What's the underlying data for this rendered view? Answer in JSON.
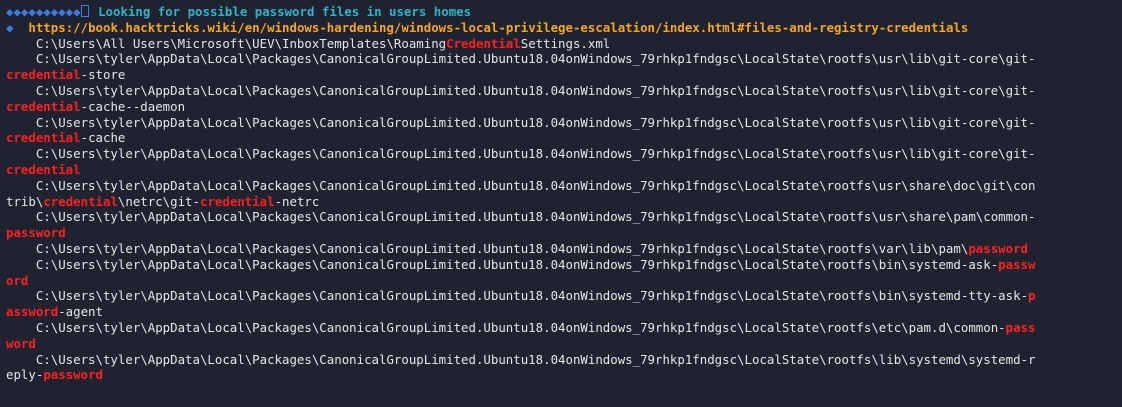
{
  "header": {
    "diamonds": "◆◆◆◆◆◆◆◆◆◆",
    "title": "Looking for possible password files in users homes"
  },
  "reference": {
    "bullet": "◆",
    "url": "https://book.hacktricks.wiki/en/windows-hardening/windows-local-privilege-escalation/index.html#files-and-registry-credentials"
  },
  "lines": [
    [
      "    C:\\Users\\All Users\\Microsoft\\UEV\\InboxTemplates\\Roaming",
      "Credential",
      "Settings.xml"
    ],
    [
      "    C:\\Users\\tyler\\AppData\\Local\\Packages\\CanonicalGroupLimited.Ubuntu18.04onWindows_79rhkp1fndgsc\\LocalState\\rootfs\\usr\\lib\\git-core\\git-"
    ],
    [
      "",
      "credential",
      "-store"
    ],
    [
      "    C:\\Users\\tyler\\AppData\\Local\\Packages\\CanonicalGroupLimited.Ubuntu18.04onWindows_79rhkp1fndgsc\\LocalState\\rootfs\\usr\\lib\\git-core\\git-"
    ],
    [
      "",
      "credential",
      "-cache--daemon"
    ],
    [
      "    C:\\Users\\tyler\\AppData\\Local\\Packages\\CanonicalGroupLimited.Ubuntu18.04onWindows_79rhkp1fndgsc\\LocalState\\rootfs\\usr\\lib\\git-core\\git-"
    ],
    [
      "",
      "credential",
      "-cache"
    ],
    [
      "    C:\\Users\\tyler\\AppData\\Local\\Packages\\CanonicalGroupLimited.Ubuntu18.04onWindows_79rhkp1fndgsc\\LocalState\\rootfs\\usr\\lib\\git-core\\git-"
    ],
    [
      "",
      "credential"
    ],
    [
      "    C:\\Users\\tyler\\AppData\\Local\\Packages\\CanonicalGroupLimited.Ubuntu18.04onWindows_79rhkp1fndgsc\\LocalState\\rootfs\\usr\\share\\doc\\git\\con"
    ],
    [
      "trib\\",
      "credential",
      "\\netrc\\git-",
      "credential",
      "-netrc"
    ],
    [
      "    C:\\Users\\tyler\\AppData\\Local\\Packages\\CanonicalGroupLimited.Ubuntu18.04onWindows_79rhkp1fndgsc\\LocalState\\rootfs\\usr\\share\\pam\\common-"
    ],
    [
      "",
      "password"
    ],
    [
      "    C:\\Users\\tyler\\AppData\\Local\\Packages\\CanonicalGroupLimited.Ubuntu18.04onWindows_79rhkp1fndgsc\\LocalState\\rootfs\\var\\lib\\pam\\",
      "password"
    ],
    [
      "    C:\\Users\\tyler\\AppData\\Local\\Packages\\CanonicalGroupLimited.Ubuntu18.04onWindows_79rhkp1fndgsc\\LocalState\\rootfs\\bin\\systemd-ask-",
      "passw"
    ],
    [
      "",
      "ord"
    ],
    [
      "    C:\\Users\\tyler\\AppData\\Local\\Packages\\CanonicalGroupLimited.Ubuntu18.04onWindows_79rhkp1fndgsc\\LocalState\\rootfs\\bin\\systemd-tty-ask-",
      "p"
    ],
    [
      "",
      "assword",
      "-agent"
    ],
    [
      "    C:\\Users\\tyler\\AppData\\Local\\Packages\\CanonicalGroupLimited.Ubuntu18.04onWindows_79rhkp1fndgsc\\LocalState\\rootfs\\etc\\pam.d\\common-",
      "pass"
    ],
    [
      "",
      "word"
    ],
    [
      "    C:\\Users\\tyler\\AppData\\Local\\Packages\\CanonicalGroupLimited.Ubuntu18.04onWindows_79rhkp1fndgsc\\LocalState\\rootfs\\lib\\systemd\\systemd-r"
    ],
    [
      "eply-",
      "password"
    ]
  ]
}
